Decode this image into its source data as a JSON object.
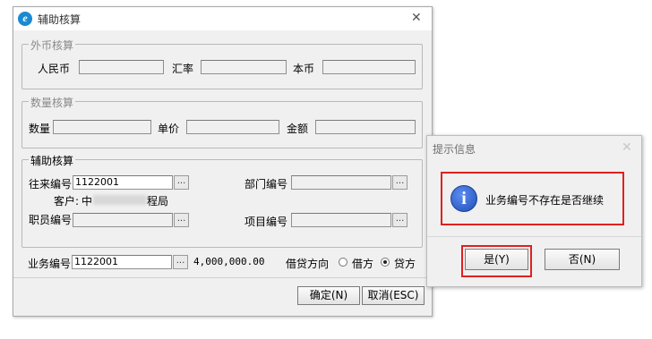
{
  "main_dialog": {
    "title": "辅助核算",
    "foreign_currency": {
      "legend": "外币核算",
      "rmb_label": "人民币",
      "rate_label": "汇率",
      "base_label": "本币"
    },
    "quantity": {
      "legend": "数量核算",
      "qty_label": "数量",
      "price_label": "单价",
      "amount_label": "金额"
    },
    "aux": {
      "legend": "辅助核算",
      "account_label": "往来编号",
      "account_value": "1122001",
      "customer_prefix": "客户:",
      "customer_start": "中",
      "customer_end": "程局",
      "dept_label": "部门编号",
      "staff_label": "职员编号",
      "project_label": "项目编号",
      "dots": "..."
    },
    "business": {
      "label": "业务编号",
      "value": "1122001",
      "amount": "4,000,000.00",
      "direction_label": "借贷方向",
      "debit_label": "借方",
      "credit_label": "贷方",
      "selected": "credit"
    },
    "ok_label": "确定(N)",
    "cancel_label": "取消(ESC)",
    "close": "✕"
  },
  "prompt_dialog": {
    "title": "提示信息",
    "message": "业务编号不存在是否继续",
    "yes_label": "是(Y)",
    "no_label": "否(N)",
    "close": "✕",
    "info_glyph": "i"
  },
  "colors": {
    "highlight": "#e02020",
    "info_blue": "#2a5bc8"
  },
  "icons": [
    "app-icon",
    "close-icon",
    "info-icon"
  ]
}
